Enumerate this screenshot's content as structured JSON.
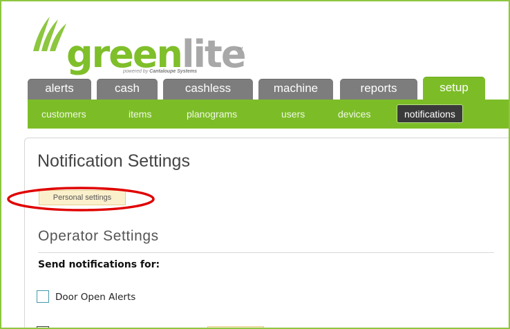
{
  "logo": {
    "word_green": "green",
    "word_gray": "lite",
    "trademark": "™",
    "powered_prefix": "powered by ",
    "powered_company": "Cantaloupe Systems",
    "green_color": "#7fbf2a",
    "gray_color": "#a8a8a8"
  },
  "tabs": [
    {
      "label": "alerts",
      "active": false
    },
    {
      "label": "cash",
      "active": false
    },
    {
      "label": "cashless",
      "active": false
    },
    {
      "label": "machine",
      "active": false
    },
    {
      "label": "reports",
      "active": false
    },
    {
      "label": "setup",
      "active": true
    }
  ],
  "subnav": [
    {
      "label": "customers",
      "active": false
    },
    {
      "label": "items",
      "active": false
    },
    {
      "label": "planograms",
      "active": false
    },
    {
      "label": "users",
      "active": false
    },
    {
      "label": "devices",
      "active": false
    },
    {
      "label": "notifications",
      "active": true
    }
  ],
  "main": {
    "title": "Notification Settings",
    "personal_button": "Personal settings",
    "section_title": "Operator Settings",
    "send_label": "Send notifications for:",
    "options": [
      {
        "label": "Door Open Alerts",
        "checked": false
      }
    ]
  },
  "colors": {
    "accent_green": "#7cbd27",
    "tab_gray": "#7d7d7d",
    "active_subnav": "#3a3a3a",
    "highlight_red": "#e00000",
    "button_bg": "#fbf0cc"
  }
}
